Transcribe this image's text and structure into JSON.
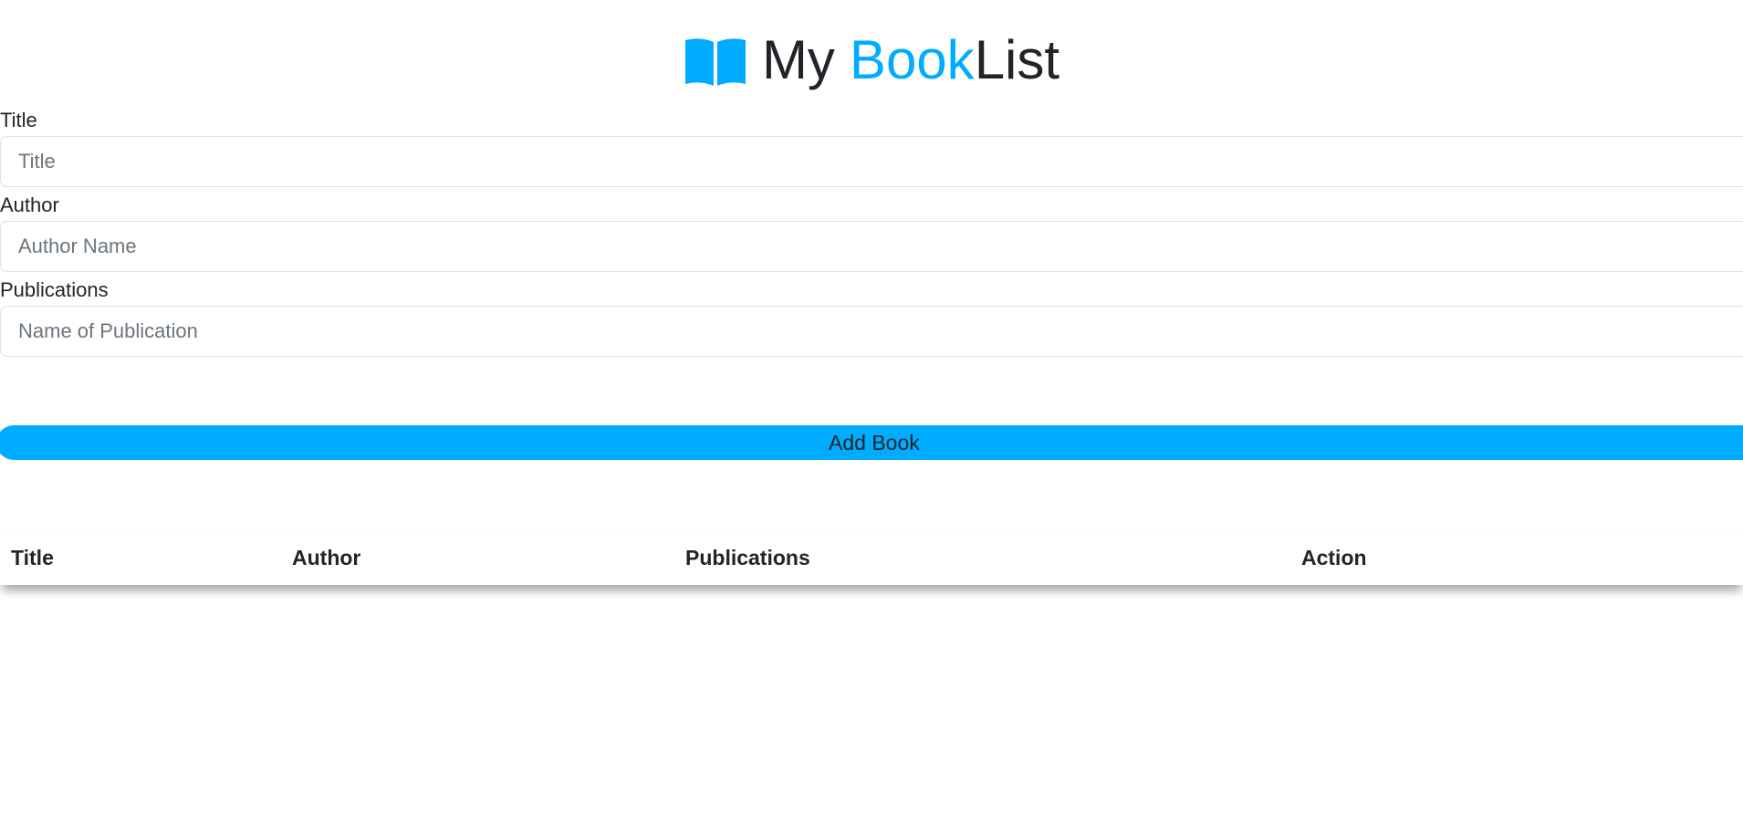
{
  "header": {
    "title_my": "My",
    "title_book": "Book",
    "title_list": "List",
    "icon": "open-book-icon",
    "accent_color": "#00acff"
  },
  "form": {
    "title": {
      "label": "Title",
      "placeholder": "Title",
      "value": ""
    },
    "author": {
      "label": "Author",
      "placeholder": "Author Name",
      "value": ""
    },
    "publications": {
      "label": "Publications",
      "placeholder": "Name of Publication",
      "value": ""
    },
    "submit_label": "Add Book"
  },
  "table": {
    "columns": [
      "Title",
      "Author",
      "Publications",
      "Action"
    ],
    "rows": []
  }
}
